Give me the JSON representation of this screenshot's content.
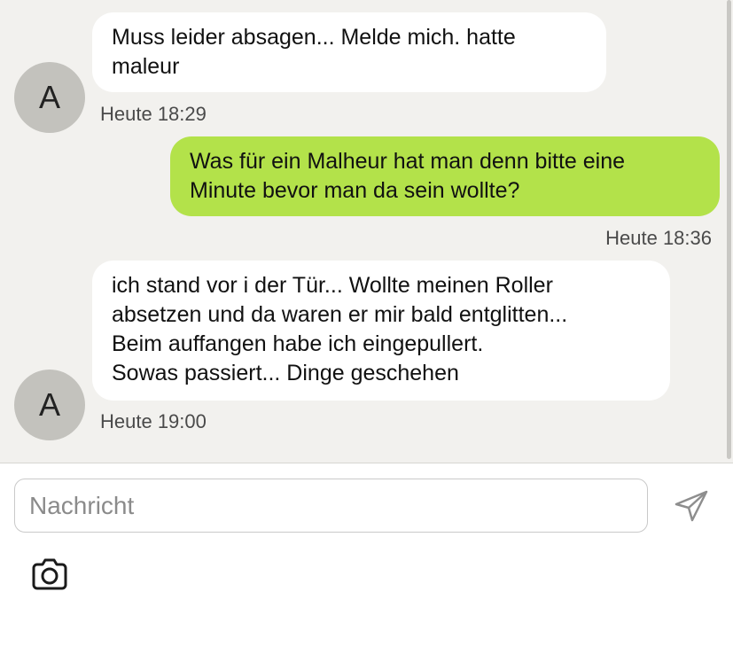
{
  "messages": [
    {
      "direction": "incoming",
      "avatar_letter": "A",
      "lines": [
        "Muss leider absagen... Melde mich. hatte",
        "maleur"
      ],
      "time": "Heute 18:29"
    },
    {
      "direction": "outgoing",
      "lines": [
        "Was für ein Malheur hat man denn bitte eine",
        "Minute bevor man da sein wollte?"
      ],
      "time": "Heute 18:36"
    },
    {
      "direction": "incoming",
      "avatar_letter": "A",
      "lines": [
        "ich stand vor i der Tür... Wollte meinen Roller",
        "absetzen und da waren er mir bald entglitten...",
        "Beim auffangen habe ich eingepullert.",
        "Sowas passiert... Dinge geschehen"
      ],
      "time": "Heute 19:00"
    }
  ],
  "composer": {
    "placeholder": "Nachricht",
    "send_icon": "send-icon",
    "camera_icon": "camera-icon"
  },
  "colors": {
    "chat_background": "#f2f1ee",
    "incoming_bubble": "#ffffff",
    "outgoing_bubble": "#b3e24a",
    "avatar": "#c3c2bd"
  }
}
